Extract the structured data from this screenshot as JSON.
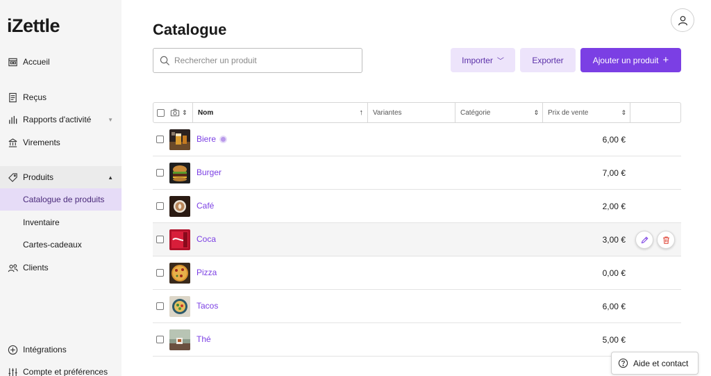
{
  "app": {
    "logo": "iZettle"
  },
  "sidebar": {
    "items": [
      {
        "label": "Accueil",
        "icon": "home-icon"
      },
      {
        "label": "Reçus",
        "icon": "receipt-icon"
      },
      {
        "label": "Rapports d'activité",
        "icon": "bar-chart-icon"
      },
      {
        "label": "Virements",
        "icon": "bank-icon"
      },
      {
        "label": "Produits",
        "icon": "tag-icon"
      },
      {
        "label": "Catalogue de produits"
      },
      {
        "label": "Inventaire"
      },
      {
        "label": "Cartes-cadeaux"
      },
      {
        "label": "Clients",
        "icon": "users-icon"
      },
      {
        "label": "Intégrations",
        "icon": "plus-circle-icon"
      },
      {
        "label": "Compte et préférences",
        "icon": "sliders-icon"
      }
    ]
  },
  "header": {
    "title": "Catalogue"
  },
  "search": {
    "placeholder": "Rechercher un produit"
  },
  "toolbar": {
    "import_label": "Importer",
    "export_label": "Exporter",
    "add_label": "Ajouter un produit"
  },
  "table": {
    "columns": {
      "name": "Nom",
      "variants": "Variantes",
      "category": "Catégorie",
      "price": "Prix de vente"
    },
    "rows": [
      {
        "name": "Biere",
        "price": "6,00 €"
      },
      {
        "name": "Burger",
        "price": "7,00 €"
      },
      {
        "name": "Café",
        "price": "2,00 €"
      },
      {
        "name": "Coca",
        "price": "3,00 €"
      },
      {
        "name": "Pizza",
        "price": "0,00 €"
      },
      {
        "name": "Tacos",
        "price": "6,00 €"
      },
      {
        "name": "Thé",
        "price": "5,00 €"
      }
    ]
  },
  "help": {
    "label": "Aide et contact"
  },
  "colors": {
    "accent": "#7b3fe4",
    "accent_light": "#ede4fb",
    "sidebar_bg": "#f5f5f5",
    "active_bg": "#e6dcf7"
  }
}
